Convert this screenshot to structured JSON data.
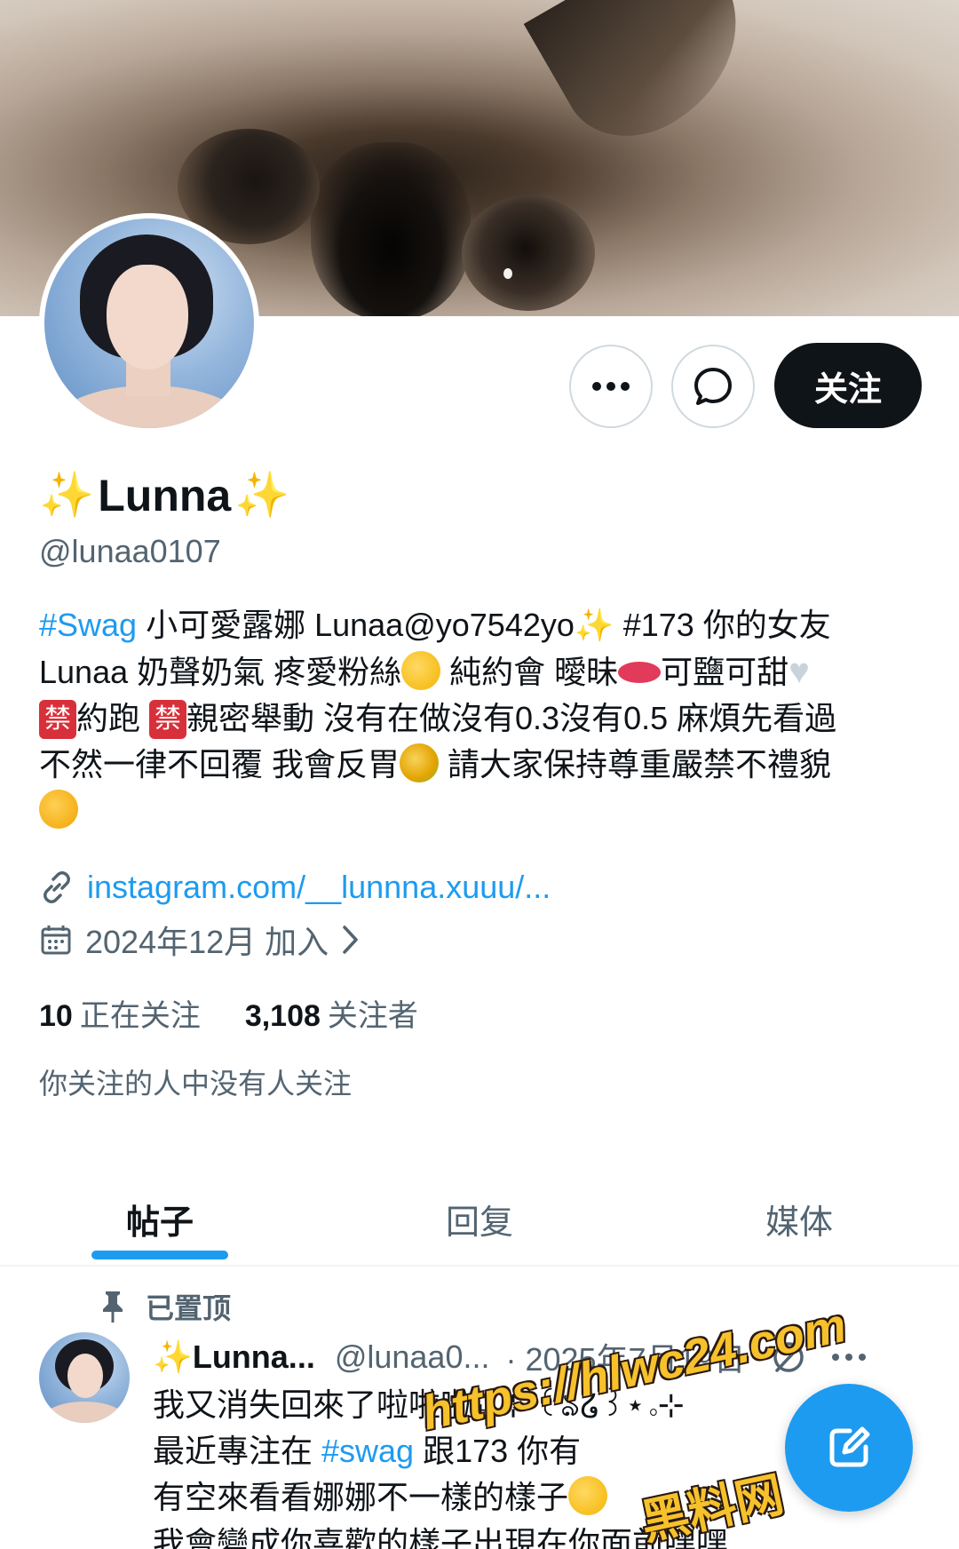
{
  "profile": {
    "name": "Lunna",
    "handle": "@lunaa0107",
    "bio": {
      "l1a": "#Swag",
      "l1b": " 小可愛露娜 Lunaa@yo7542yo",
      "l1c": " #173 你的女友",
      "l2a": "Lunaa 奶聲奶氣 疼愛粉絲",
      "l2b": " 純約會 曖昧",
      "l2c": "可鹽可甜",
      "ban": "禁",
      "l3a": "約跑 ",
      "l3b": "親密舉動 沒有在做沒有0.3沒有0.5 麻煩先看過",
      "l4a": "不然一律不回覆 我會反胃",
      "l4b": " 請大家保持尊重嚴禁不禮貌"
    },
    "link": "instagram.com/__lunnna.xuuu/...",
    "joined": "2024年12月 加入",
    "following_count": "10",
    "following_label": "正在关注",
    "followers_count": "3,108",
    "followers_label": "关注者",
    "followed_by": "你关注的人中没有人关注"
  },
  "actions": {
    "follow_label": "关注"
  },
  "tabs": [
    {
      "label": "帖子",
      "active": true
    },
    {
      "label": "回复",
      "active": false
    },
    {
      "label": "媒体",
      "active": false
    }
  ],
  "pinned_label": "已置顶",
  "post": {
    "name": "Lunna...",
    "handle": "@lunaa0...",
    "date": "· 2025年7月19日",
    "line1": "我又消失回來了啦啦啦₊˚⊹ ꒰ঌ໒꒱⋆｡⊹",
    "line2a": "最近專注在 ",
    "line2b": "#swag",
    "line2c": " 跟173 你有",
    "line3": "有空來看看娜娜不一樣的樣子",
    "line4": "我會變成你喜歡的樣子出現在你面前嘿嘿"
  },
  "watermark": {
    "url": "https://hlwc24.com",
    "cn": "黑料网"
  },
  "colors": {
    "accent": "#1d9bf0",
    "text": "#0f1419",
    "muted": "#536471",
    "follow_bg": "#0f1419"
  },
  "icons": [
    "more-icon",
    "message-icon",
    "link-icon",
    "calendar-icon",
    "chevron-right-icon",
    "pin-icon",
    "grok-icon",
    "compose-icon",
    "sparkle-icon"
  ]
}
